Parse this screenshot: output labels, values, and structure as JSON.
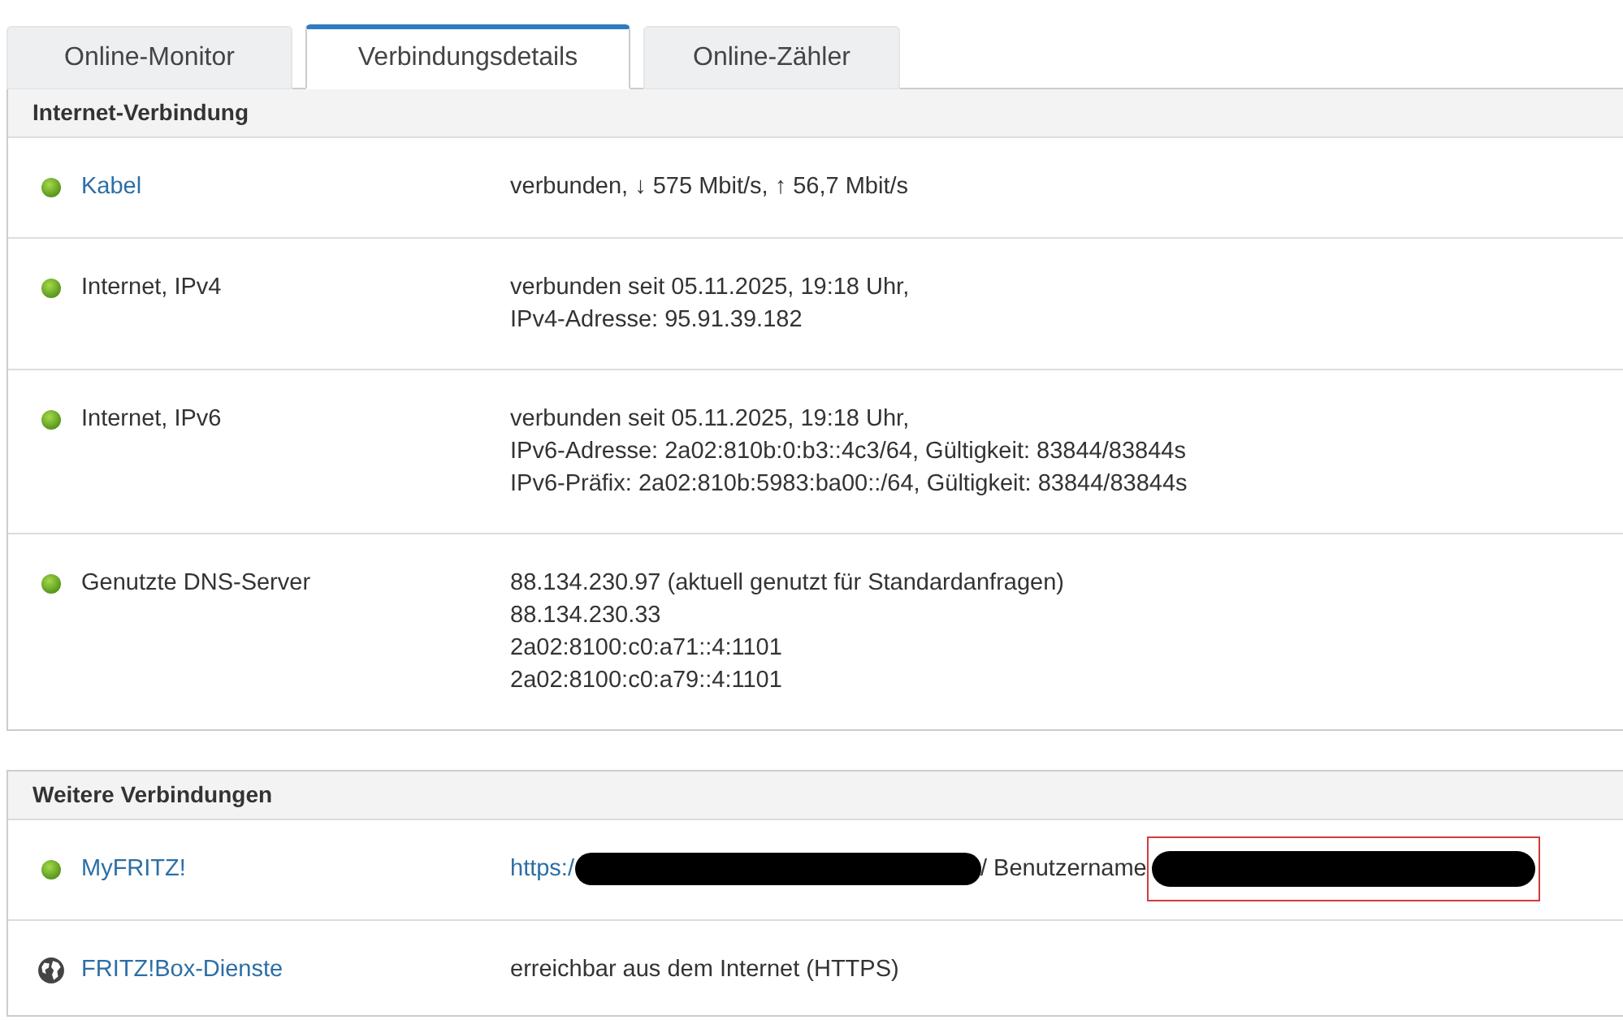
{
  "tabs": [
    {
      "label": "Online-Monitor",
      "selected": false
    },
    {
      "label": "Verbindungsdetails",
      "selected": true
    },
    {
      "label": "Online-Zähler",
      "selected": false
    }
  ],
  "sections": [
    {
      "title": "Internet-Verbindung",
      "rows": [
        {
          "kind": "dot",
          "name": "Kabel",
          "link": true,
          "lines": [
            "verbunden, ↓ 575 Mbit/s, ↑ 56,7 Mbit/s"
          ]
        },
        {
          "kind": "dot",
          "name": "Internet, IPv4",
          "link": false,
          "lines": [
            "verbunden seit 05.11.2025, 19:18 Uhr,",
            "IPv4-Adresse: 95.91.39.182"
          ]
        },
        {
          "kind": "dot",
          "name": "Internet, IPv6",
          "link": false,
          "lines": [
            "verbunden seit 05.11.2025, 19:18 Uhr,",
            "IPv6-Adresse: 2a02:810b:0:b3::4c3/64, Gültigkeit: 83844/83844s",
            "IPv6-Präfix: 2a02:810b:5983:ba00::/64, Gültigkeit: 83844/83844s"
          ]
        },
        {
          "kind": "dot",
          "name": "Genutzte DNS-Server",
          "link": false,
          "lines": [
            "88.134.230.97 (aktuell genutzt für Standardanfragen)",
            "88.134.230.33",
            "2a02:8100:c0:a71::4:1101",
            "2a02:8100:c0:a79::4:1101"
          ]
        }
      ]
    },
    {
      "title": "Weitere Verbindungen",
      "rows": [
        {
          "kind": "dot",
          "name": "MyFRITZ!",
          "link": true,
          "segments": [
            {
              "kind": "link",
              "text": "https:/"
            },
            {
              "kind": "redaction",
              "highlighted": false
            },
            {
              "kind": "text",
              "text": "/ Benutzername"
            },
            {
              "kind": "redaction",
              "highlighted": true
            }
          ]
        },
        {
          "kind": "globe",
          "name": "FRITZ!Box-Dienste",
          "link": true,
          "lines": [
            "erreichbar aus dem Internet (HTTPS)"
          ]
        }
      ]
    }
  ]
}
